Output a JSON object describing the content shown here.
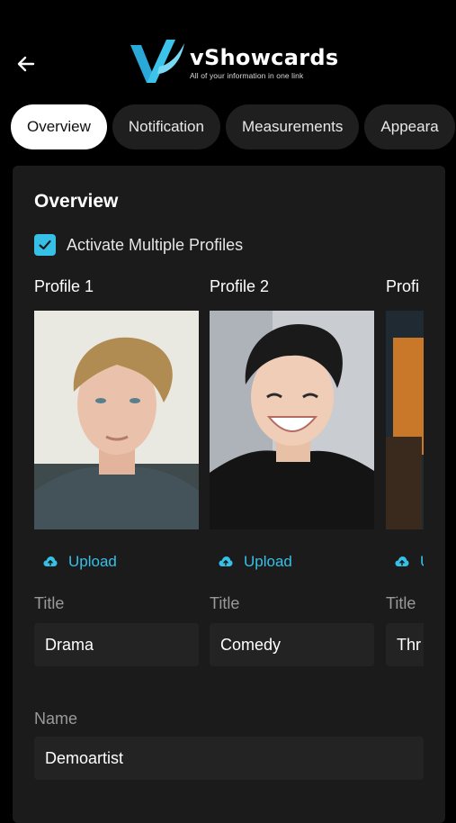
{
  "header": {
    "back_icon": "arrow-left-icon",
    "logo_title": "vShowcards",
    "logo_tagline": "All of your information in one link"
  },
  "tabs": [
    {
      "label": "Overview",
      "active": true
    },
    {
      "label": "Notification",
      "active": false
    },
    {
      "label": "Measurements",
      "active": false
    },
    {
      "label": "Appeara",
      "active": false
    }
  ],
  "overview": {
    "title": "Overview",
    "multi_profile_label": "Activate Multiple Profiles",
    "multi_profile_checked": true,
    "profiles": [
      {
        "name": "Profile 1",
        "upload_label": "Upload",
        "title_label": "Title",
        "title_value": "Drama"
      },
      {
        "name": "Profile 2",
        "upload_label": "Upload",
        "title_label": "Title",
        "title_value": "Comedy"
      },
      {
        "name": "Profi",
        "upload_label": "U",
        "title_label": "Title",
        "title_value": "Thr"
      }
    ],
    "name_label": "Name",
    "name_value": "Demoartist"
  },
  "colors": {
    "accent": "#36c0e6",
    "background": "#000000",
    "card": "#1b1b1b",
    "field": "#232323"
  }
}
